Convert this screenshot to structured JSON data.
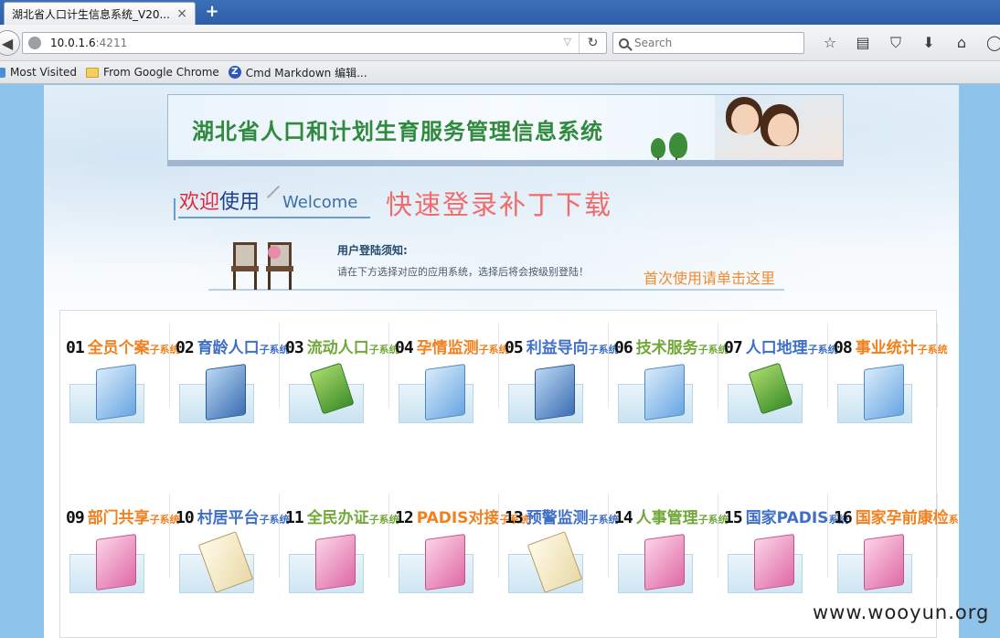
{
  "browser": {
    "tab_title": "湖北省人口计生信息系统_V20...",
    "tab_close": "×",
    "new_tab": "+",
    "url_host": "10.0.1.6",
    "url_port": ":4211",
    "search_placeholder": "Search",
    "bookmarks": [
      {
        "label": "Most Visited",
        "icon": "gear-icon"
      },
      {
        "label": "From Google Chrome",
        "icon": "folder-icon"
      },
      {
        "label": "Cmd Markdown 编辑...",
        "icon": "zybook-icon"
      }
    ]
  },
  "page": {
    "banner_title": "湖北省人口和计划生育服务管理信息系统",
    "welcome_cn1": "欢迎",
    "welcome_cn2": "使用",
    "welcome_en": "Welcome",
    "patch_link": "快速登录补丁下载",
    "notice_title": "用户登陆须知:",
    "notice_desc": "请在下方选择对应的应用系统，选择后将会按级别登陆！",
    "first_use_link": "首次使用请单击这里"
  },
  "systems_row1": [
    {
      "num": "01",
      "name": "全员个案",
      "suffix": "子系统",
      "color": "orange",
      "icon": "folder-blue"
    },
    {
      "num": "02",
      "name": "育龄人口",
      "suffix": "子系统",
      "color": "blue",
      "icon": "folder-dark"
    },
    {
      "num": "03",
      "name": "流动人口",
      "suffix": "子系统",
      "color": "green",
      "icon": "book"
    },
    {
      "num": "04",
      "name": "孕情监测",
      "suffix": "子系统",
      "color": "orange",
      "icon": "folder-blue"
    },
    {
      "num": "05",
      "name": "利益导向",
      "suffix": "子系统",
      "color": "blue",
      "icon": "folder-dark"
    },
    {
      "num": "06",
      "name": "技术服务",
      "suffix": "子系统",
      "color": "green",
      "icon": "folder-blue"
    },
    {
      "num": "07",
      "name": "人口地理",
      "suffix": "子系统",
      "color": "blue",
      "icon": "book"
    },
    {
      "num": "08",
      "name": "事业统计",
      "suffix": "子系统",
      "color": "orange",
      "icon": "folder-blue"
    }
  ],
  "systems_row2": [
    {
      "num": "09",
      "name": "部门共享",
      "suffix": "子系统",
      "color": "orange",
      "icon": "pink"
    },
    {
      "num": "10",
      "name": "村居平台",
      "suffix": "子系统",
      "color": "blue",
      "icon": "note"
    },
    {
      "num": "11",
      "name": "全民办证",
      "suffix": "子系统",
      "color": "green",
      "icon": "pink"
    },
    {
      "num": "12",
      "name": "PADIS对接",
      "suffix": "子系统",
      "color": "orange",
      "icon": "pink"
    },
    {
      "num": "13",
      "name": "预警监测",
      "suffix": "子系统",
      "color": "blue",
      "icon": "note"
    },
    {
      "num": "14",
      "name": "人事管理",
      "suffix": "子系统",
      "color": "green",
      "icon": "pink"
    },
    {
      "num": "15",
      "name": "国家PADIS",
      "suffix": "系统",
      "color": "blue",
      "icon": "pink"
    },
    {
      "num": "16",
      "name": "国家孕前康检",
      "suffix": "系统",
      "color": "orange",
      "icon": "pink"
    }
  ],
  "watermark": "www.wooyun.org"
}
